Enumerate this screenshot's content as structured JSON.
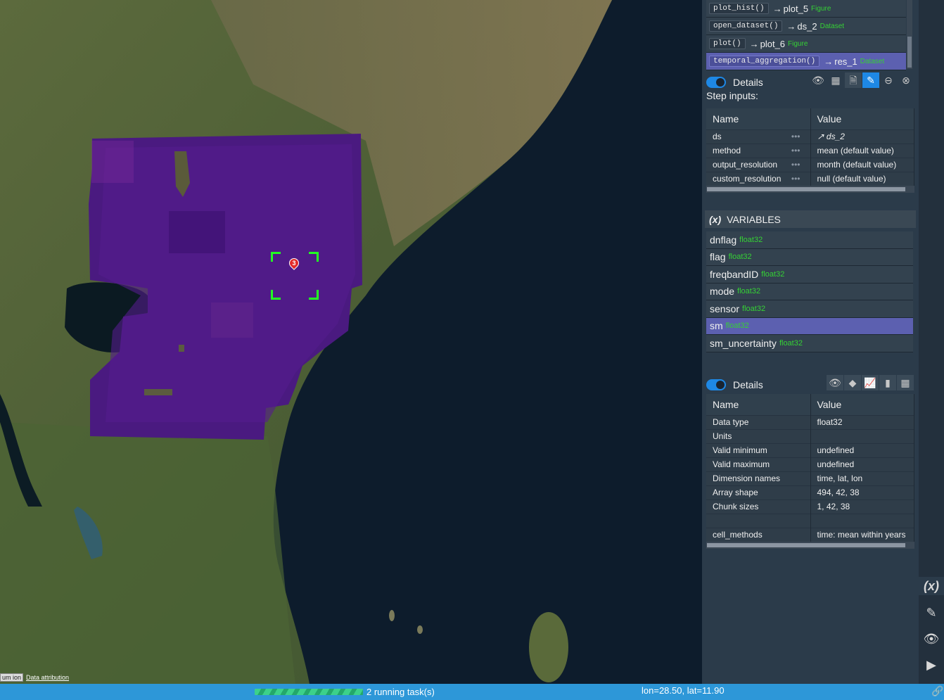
{
  "map": {
    "attribution_cesium": "um ion",
    "attribution_link": "Data attribution",
    "marker_number": "3"
  },
  "workflow_steps": [
    {
      "fn": "plot_hist()",
      "result": "plot_5",
      "type": "Figure"
    },
    {
      "fn": "open_dataset()",
      "result": "ds_2",
      "type": "Dataset"
    },
    {
      "fn": "plot()",
      "result": "plot_6",
      "type": "Figure"
    },
    {
      "fn": "temporal_aggregation()",
      "result": "res_1",
      "type": "Dataset",
      "selected": true
    }
  ],
  "step_arrow": "→",
  "step_details": {
    "toggle_label": "Details",
    "step_inputs_label": "Step inputs:",
    "headers": [
      "Name",
      "Value"
    ],
    "rows": [
      {
        "name": "ds",
        "value": "↗ ds_2"
      },
      {
        "name": "method",
        "value": "mean (default value)"
      },
      {
        "name": "output_resolution",
        "value": "month (default value)"
      },
      {
        "name": "custom_resolution",
        "value": "null (default value)"
      }
    ],
    "dots": "•••"
  },
  "variables": {
    "header_icon": "(x)",
    "header_label": "VARIABLES",
    "items": [
      {
        "name": "dnflag",
        "type": "float32"
      },
      {
        "name": "flag",
        "type": "float32"
      },
      {
        "name": "freqbandID",
        "type": "float32"
      },
      {
        "name": "mode",
        "type": "float32"
      },
      {
        "name": "sensor",
        "type": "float32"
      },
      {
        "name": "sm",
        "type": "float32",
        "selected": true
      },
      {
        "name": "sm_uncertainty",
        "type": "float32"
      }
    ]
  },
  "var_details": {
    "toggle_label": "Details",
    "headers": [
      "Name",
      "Value"
    ],
    "rows": [
      {
        "name": "Data type",
        "value": "float32"
      },
      {
        "name": "Units",
        "value": ""
      },
      {
        "name": "Valid minimum",
        "value": "undefined"
      },
      {
        "name": "Valid maximum",
        "value": "undefined"
      },
      {
        "name": "Dimension names",
        "value": "time, lat, lon"
      },
      {
        "name": "Array shape",
        "value": "494, 42, 38"
      },
      {
        "name": "Chunk sizes",
        "value": "1, 42, 38"
      },
      {
        "name": "",
        "value": ""
      },
      {
        "name": "cell_methods",
        "value": "time: mean within years"
      }
    ]
  },
  "right_toolbar": {
    "variables_icon": "(x)"
  },
  "status": {
    "tasks": "2 running task(s)",
    "coords": "lon=28.50, lat=11.90"
  },
  "colors": {
    "accent": "#1e88e5",
    "selection": "#5c60b0",
    "status_bar": "#2d97d8",
    "type_green": "#35d135"
  }
}
